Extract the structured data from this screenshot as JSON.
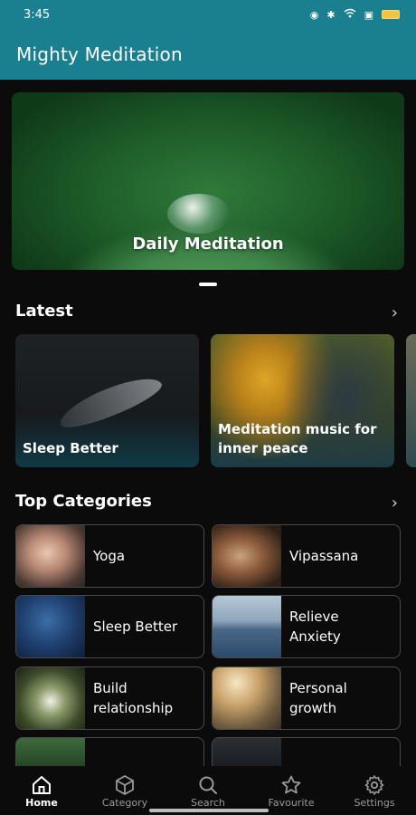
{
  "status_bar": {
    "time": "3:45"
  },
  "app_bar": {
    "title": "Mighty Meditation"
  },
  "banner": {
    "title": "Daily Meditation"
  },
  "latest": {
    "title": "Latest",
    "cards": [
      {
        "label": "Sleep Better"
      },
      {
        "label": "Meditation music for inner peace"
      }
    ]
  },
  "top_categories": {
    "title": "Top Categories",
    "items": [
      {
        "label": "Yoga"
      },
      {
        "label": "Vipassana"
      },
      {
        "label": "Sleep Better"
      },
      {
        "label": "Relieve Anxiety"
      },
      {
        "label": "Build relationship"
      },
      {
        "label": "Personal growth"
      }
    ]
  },
  "bottom_nav": {
    "items": [
      {
        "label": "Home",
        "icon": "home-icon",
        "active": true
      },
      {
        "label": "Category",
        "icon": "cube-icon"
      },
      {
        "label": "Search",
        "icon": "search-icon"
      },
      {
        "label": "Favourite",
        "icon": "star-icon"
      },
      {
        "label": "Settings",
        "icon": "gear-icon"
      }
    ]
  },
  "colors": {
    "accent": "#1a7f8f",
    "background": "#0b0b0b"
  }
}
